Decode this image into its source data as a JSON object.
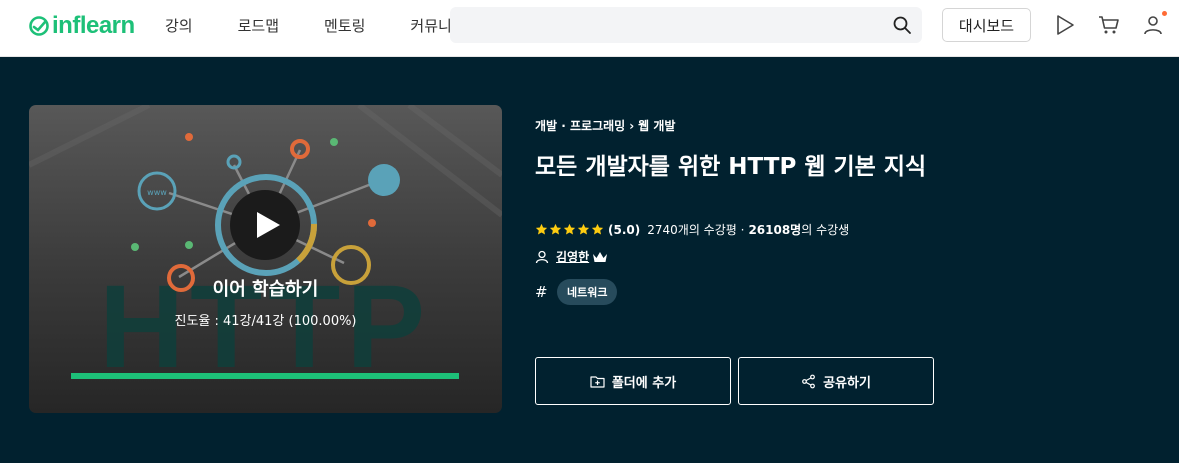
{
  "header": {
    "logo_text": "inflearn",
    "nav": [
      "강의",
      "로드맵",
      "멘토링",
      "커뮤니티"
    ],
    "search": {
      "value": "",
      "placeholder": ""
    },
    "dashboard_label": "대시보드",
    "accent_color": "#1dc078",
    "notification_dot_color": "#ff6b35"
  },
  "hero": {
    "background_color": "#01212f",
    "thumbnail": {
      "watermark_text": "HTTP",
      "www_label": "www",
      "resume_label": "이어 학습하기",
      "progress_text": "진도율 : 41강/41강 (100.00%)",
      "progress_percent": 100
    },
    "breadcrumb": [
      "개발 · 프로그래밍",
      "웹 개발"
    ],
    "title": "모든 개발자를 위한 HTTP 웹 기본 지식",
    "rating": {
      "stars": 5,
      "score": "(5.0)",
      "reviews_count": "2740",
      "reviews_suffix": "개의 수강평 ·",
      "students_count": "26108명",
      "students_suffix": "의 수강생"
    },
    "instructor": "김영한",
    "tags": [
      "네트워크"
    ],
    "buttons": {
      "folder": "폴더에 추가",
      "share": "공유하기"
    }
  },
  "icons": [
    "play-icon",
    "cart-icon",
    "user-icon",
    "search-icon",
    "star-icon",
    "person-icon",
    "crown-icon",
    "hash-icon",
    "folder-plus-icon",
    "share-icon"
  ]
}
